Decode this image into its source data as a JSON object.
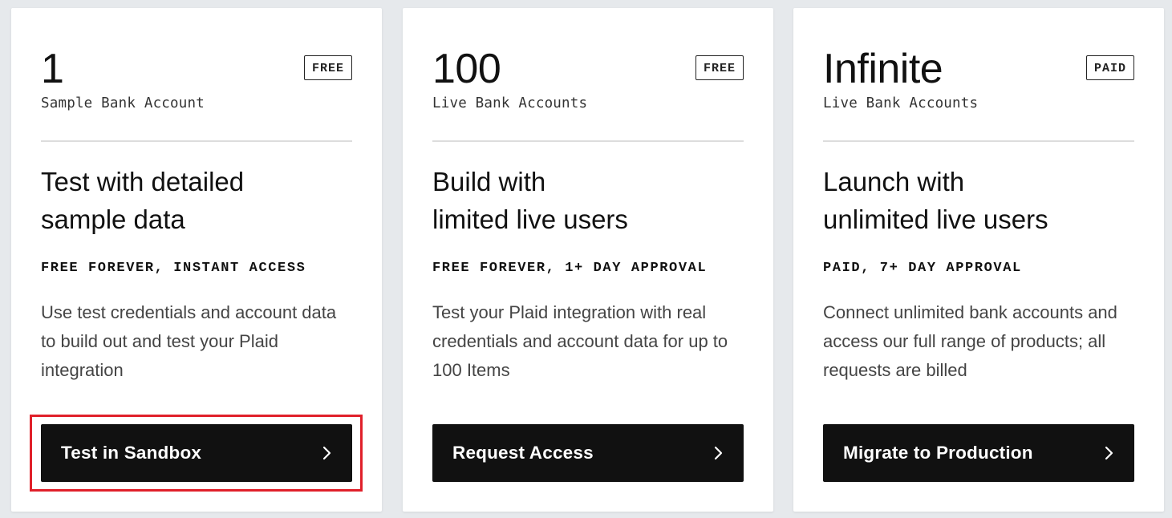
{
  "cards": [
    {
      "count": "1",
      "badge": "FREE",
      "unit": "Sample Bank Account",
      "heading_line1": "Test with detailed",
      "heading_line2": "sample data",
      "tagline": "FREE FOREVER, INSTANT ACCESS",
      "description": "Use test credentials and account data to build out and test your Plaid integration",
      "button_label": "Test in Sandbox",
      "button_icon": "chevron-right-icon"
    },
    {
      "count": "100",
      "badge": "FREE",
      "unit": "Live Bank Accounts",
      "heading_line1": "Build with",
      "heading_line2": "limited live users",
      "tagline": "FREE FOREVER, 1+ DAY APPROVAL",
      "description": "Test your Plaid integration with real credentials and account data for up to 100 Items",
      "button_label": "Request Access",
      "button_icon": "chevron-right-icon"
    },
    {
      "count": "Infinite",
      "badge": "PAID",
      "unit": "Live Bank Accounts",
      "heading_line1": "Launch with",
      "heading_line2": "unlimited live users",
      "tagline": "PAID, 7+ DAY APPROVAL",
      "description": "Connect unlimited bank accounts and access our full range of products; all requests are billed",
      "button_label": "Migrate to Production",
      "button_icon": "chevron-right-icon"
    }
  ],
  "colors": {
    "page_background": "#e6e9ec",
    "card_background": "#ffffff",
    "button_background": "#111111",
    "highlight_border": "#e0202a"
  }
}
